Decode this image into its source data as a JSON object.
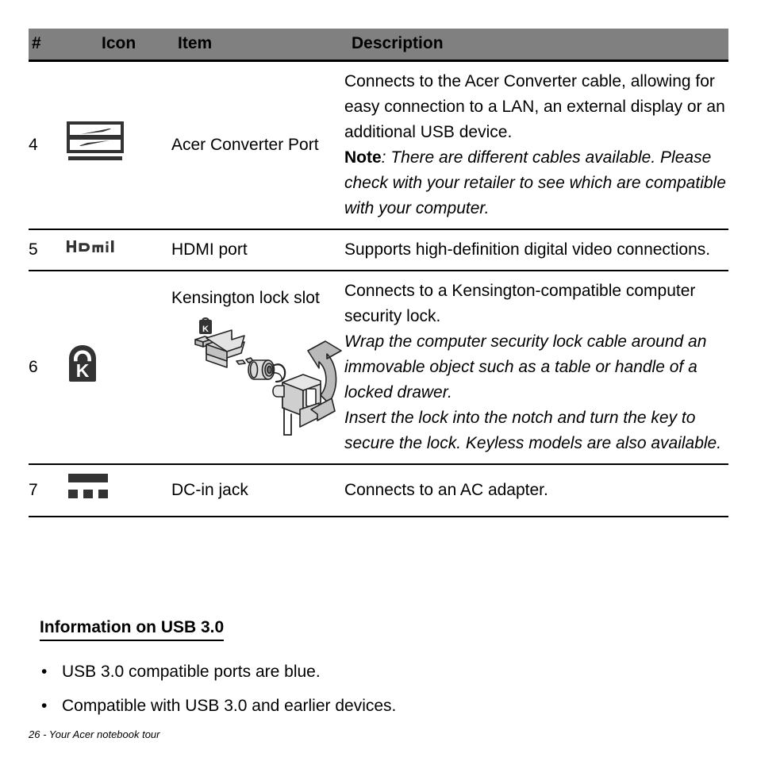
{
  "table": {
    "headers": {
      "num": "#",
      "icon": "Icon",
      "item": "Item",
      "description": "Description"
    },
    "rows": [
      {
        "num": "4",
        "icon_name": "acer-converter-port-icon",
        "item": "Acer Converter Port",
        "description_plain": "Connects to the Acer Converter cable, allowing for easy connection to a LAN, an external display or an additional USB device.",
        "note_label": "Note",
        "note_text": ": There are different cables available. Please check with your retailer to see which are compatible with your computer."
      },
      {
        "num": "5",
        "icon_name": "hdmi-icon",
        "item": "HDMI port",
        "description_plain": "Supports high-definition digital video connections."
      },
      {
        "num": "6",
        "icon_name": "kensington-lock-icon",
        "item": "Kensington lock slot",
        "illustration_name": "kensington-lock-illustration",
        "description_plain": "Connects to a Kensington-compatible computer security lock.",
        "description_italic_1": "Wrap the computer security lock cable around an immovable object such as a table or handle of a locked drawer.",
        "description_italic_2": "Insert the lock into the notch and turn the key to secure the lock. Keyless models are also available."
      },
      {
        "num": "7",
        "icon_name": "dc-in-jack-icon",
        "item": "DC-in jack",
        "description_plain": "Connects to an AC adapter."
      }
    ]
  },
  "usb_section": {
    "heading": "Information on USB 3.0",
    "bullet_glyph": "•",
    "items": [
      "USB 3.0 compatible ports are blue.",
      "Compatible with USB 3.0 and earlier devices."
    ]
  },
  "footer": {
    "text": "26 - Your Acer notebook tour"
  },
  "colors": {
    "header_background": "#808080",
    "text": "#000000",
    "rule": "#000000",
    "icon_dark": "#333333",
    "illustration_fill": "#c9c9c9",
    "page_background": "#ffffff"
  }
}
